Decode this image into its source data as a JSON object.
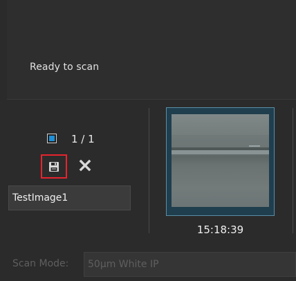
{
  "status": {
    "message": "Ready to scan"
  },
  "controls": {
    "checked": true,
    "counter": "1 / 1",
    "save_icon": "floppy-disk-icon",
    "close_icon": "close-x-icon"
  },
  "image_name": {
    "value": "TestImage1"
  },
  "thumbnail": {
    "time": "15:18:39"
  },
  "scan_mode": {
    "label": "Scan Mode:",
    "value": "50µm White IP"
  },
  "colors": {
    "accent_blue": "#1f8fd6",
    "highlight_red": "#e8232e",
    "background": "#2b2b2b"
  }
}
